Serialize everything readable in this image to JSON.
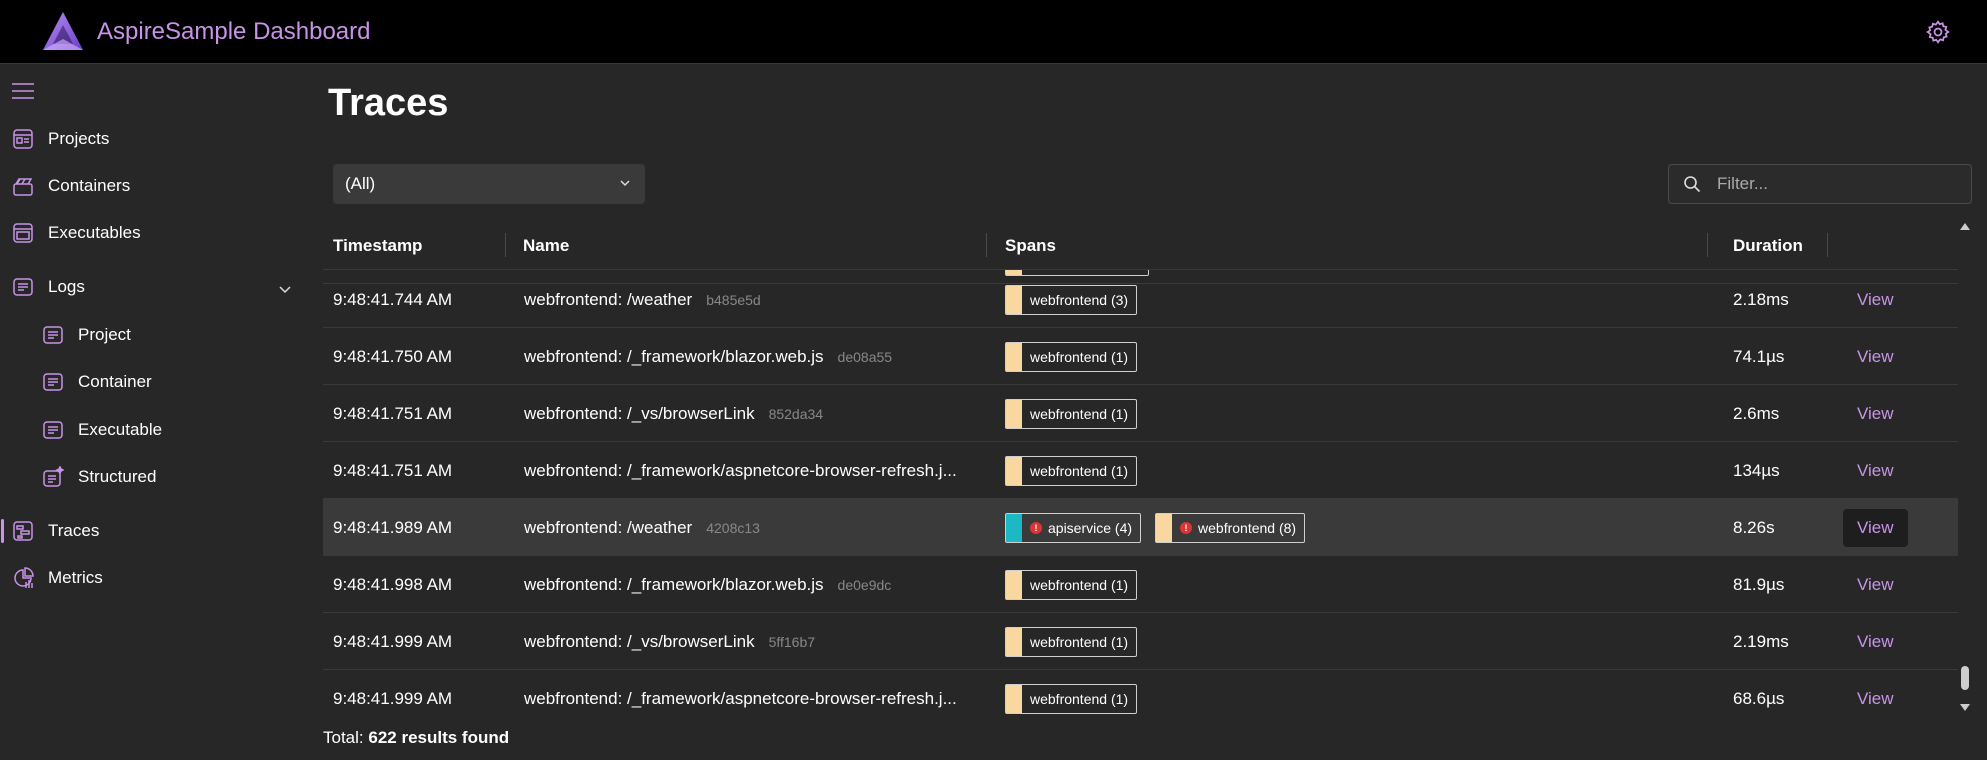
{
  "app": {
    "title": "AspireSample Dashboard"
  },
  "colors": {
    "accent": "#c893e8",
    "webfrontend": "#f8d8a0",
    "apiservice": "#1cb9c4",
    "error": "#d33"
  },
  "sidebar": {
    "items": [
      {
        "label": "Projects",
        "icon": "projects-icon"
      },
      {
        "label": "Containers",
        "icon": "containers-icon"
      },
      {
        "label": "Executables",
        "icon": "executables-icon"
      },
      {
        "label": "Logs",
        "icon": "logs-icon"
      },
      {
        "label": "Project",
        "icon": "log-project-icon"
      },
      {
        "label": "Container",
        "icon": "log-container-icon"
      },
      {
        "label": "Executable",
        "icon": "log-executable-icon"
      },
      {
        "label": "Structured",
        "icon": "structured-log-icon"
      },
      {
        "label": "Traces",
        "icon": "traces-icon",
        "active": true
      },
      {
        "label": "Metrics",
        "icon": "metrics-icon"
      }
    ]
  },
  "main": {
    "title": "Traces",
    "select_value": "(All)",
    "filter_placeholder": "Filter...",
    "columns": [
      "Timestamp",
      "Name",
      "Spans",
      "Duration"
    ],
    "view_label": "View",
    "rows": [
      {
        "timestamp": "9:48:41.744 AM",
        "name": "webfrontend: /weather",
        "id": "b485e5d",
        "spans": [
          {
            "label": "webfrontend (3)",
            "color": "#f8d8a0",
            "error": false
          }
        ],
        "duration": "2.18ms"
      },
      {
        "timestamp": "9:48:41.750 AM",
        "name": "webfrontend: /_framework/blazor.web.js",
        "id": "de08a55",
        "spans": [
          {
            "label": "webfrontend (1)",
            "color": "#f8d8a0",
            "error": false
          }
        ],
        "duration": "74.1µs"
      },
      {
        "timestamp": "9:48:41.751 AM",
        "name": "webfrontend: /_vs/browserLink",
        "id": "852da34",
        "spans": [
          {
            "label": "webfrontend (1)",
            "color": "#f8d8a0",
            "error": false
          }
        ],
        "duration": "2.6ms"
      },
      {
        "timestamp": "9:48:41.751 AM",
        "name": "webfrontend: /_framework/aspnetcore-browser-refresh.j...",
        "id": "",
        "spans": [
          {
            "label": "webfrontend (1)",
            "color": "#f8d8a0",
            "error": false
          }
        ],
        "duration": "134µs"
      },
      {
        "timestamp": "9:48:41.989 AM",
        "name": "webfrontend: /weather",
        "id": "4208c13",
        "spans": [
          {
            "label": "apiservice (4)",
            "color": "#1cb9c4",
            "error": true
          },
          {
            "label": "webfrontend (8)",
            "color": "#f8d8a0",
            "error": true
          }
        ],
        "duration": "8.26s",
        "highlighted": true
      },
      {
        "timestamp": "9:48:41.998 AM",
        "name": "webfrontend: /_framework/blazor.web.js",
        "id": "de0e9dc",
        "spans": [
          {
            "label": "webfrontend (1)",
            "color": "#f8d8a0",
            "error": false
          }
        ],
        "duration": "81.9µs"
      },
      {
        "timestamp": "9:48:41.999 AM",
        "name": "webfrontend: /_vs/browserLink",
        "id": "5ff16b7",
        "spans": [
          {
            "label": "webfrontend (1)",
            "color": "#f8d8a0",
            "error": false
          }
        ],
        "duration": "2.19ms"
      },
      {
        "timestamp": "9:48:41.999 AM",
        "name": "webfrontend: /_framework/aspnetcore-browser-refresh.j...",
        "id": "",
        "spans": [
          {
            "label": "webfrontend (1)",
            "color": "#f8d8a0",
            "error": false
          }
        ],
        "duration": "68.6µs"
      }
    ],
    "total_prefix": "Total:",
    "total_value": "622 results found"
  }
}
